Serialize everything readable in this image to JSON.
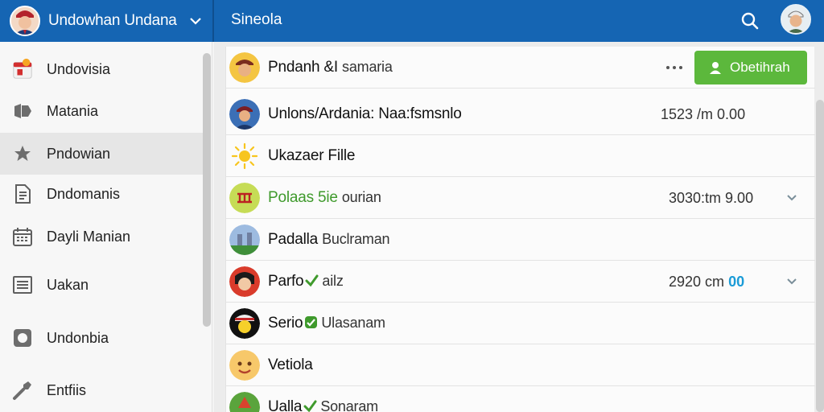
{
  "header": {
    "account_name": "Undowhan Undana",
    "section_title": "Sineola"
  },
  "sidebar": {
    "items": [
      {
        "label": "Undovisia",
        "icon": "calendar-gift-icon"
      },
      {
        "label": "Matania",
        "icon": "tag-icon"
      },
      {
        "label": "Pndowian",
        "icon": "star-icon"
      },
      {
        "label": "Dndomanis",
        "icon": "document-icon"
      },
      {
        "label": "Dayli Manian",
        "icon": "calendar-icon"
      },
      {
        "label": "Uakan",
        "icon": "list-icon"
      },
      {
        "label": "Undonbia",
        "icon": "circle-icon"
      },
      {
        "label": "Entfiis",
        "icon": "tool-icon"
      }
    ]
  },
  "list": {
    "header_row": {
      "title": "Pndanh &I",
      "subtitle": "samaria",
      "button_label": "Obetihrah"
    },
    "rows": [
      {
        "title": "Unlons/Ardania: Naa:fsmsnlo",
        "meta": "1523 /m 0.00"
      },
      {
        "title": "Ukazaer Fille"
      },
      {
        "title_accent": "Polaas 5ie",
        "subtitle": "ourian",
        "meta": "3030:tm 9.00"
      },
      {
        "title": "Padalla",
        "subtitle": "Buclraman"
      },
      {
        "title": "Parfo",
        "subtitle": "ailz",
        "meta": "2920 cm",
        "meta_accent": "00"
      },
      {
        "title": "Serio",
        "subtitle": "Ulasanam"
      },
      {
        "title": "Vetiola"
      },
      {
        "title": "Ualla",
        "subtitle": "Sonaram"
      }
    ]
  },
  "colors": {
    "header_bg": "#1565b3",
    "primary_button": "#5cb83c",
    "accent_green": "#3f9a2c",
    "accent_blue": "#1a9bd7"
  }
}
